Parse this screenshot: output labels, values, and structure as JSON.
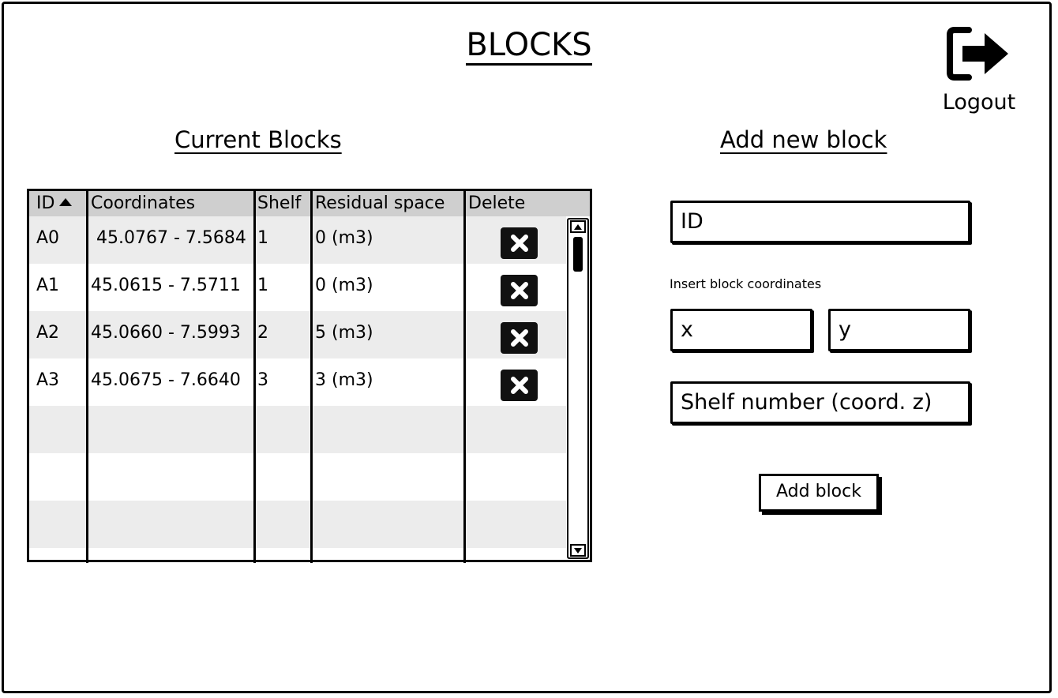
{
  "page": {
    "title": "BLOCKS"
  },
  "logout": {
    "label": "Logout",
    "icon": "logout-icon"
  },
  "current": {
    "title": "Current Blocks",
    "columns": [
      "ID",
      "Coordinates",
      "Shelf",
      "Residual space",
      "Delete"
    ],
    "sort_icon": "sort-ascending-icon",
    "rows": [
      {
        "id": "A0",
        "coordinates": "45.0767 - 7.5684",
        "shelf": "1",
        "residual": "0 (m3)"
      },
      {
        "id": "A1",
        "coordinates": "45.0615 - 7.5711",
        "shelf": "1",
        "residual": "0 (m3)"
      },
      {
        "id": "A2",
        "coordinates": "45.0660 - 7.5993",
        "shelf": "2",
        "residual": "5 (m3)"
      },
      {
        "id": "A3",
        "coordinates": "45.0675 - 7.6640",
        "shelf": "3",
        "residual": "3 (m3)"
      }
    ],
    "delete_icon": "delete-x-icon"
  },
  "add": {
    "title": "Add new block",
    "id_placeholder": "ID",
    "coords_hint": "Insert block coordinates",
    "x_placeholder": "x",
    "y_placeholder": "y",
    "shelf_placeholder": "Shelf number (coord. z)",
    "button": "Add block"
  }
}
